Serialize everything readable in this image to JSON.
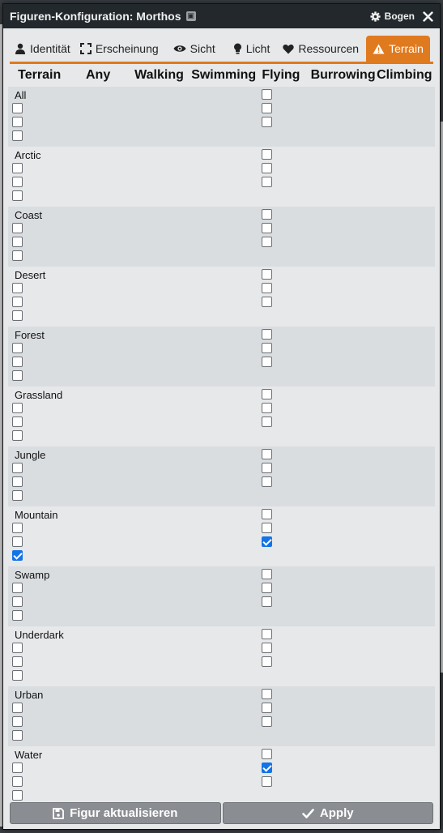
{
  "window": {
    "title": "Figuren-Konfiguration: Morthos",
    "sheet_label": "Bogen",
    "title_icon": "id-card-icon",
    "sheet_icon": "gear-icon",
    "close_icon": "close-icon"
  },
  "tabs": [
    {
      "label": "Identität",
      "icon": "user-icon",
      "active": false
    },
    {
      "label": "Erscheinung",
      "icon": "expand-icon",
      "active": false
    },
    {
      "label": "Sicht",
      "icon": "eye-icon",
      "active": false
    },
    {
      "label": "Licht",
      "icon": "lightbulb-icon",
      "active": false
    },
    {
      "label": "Ressourcen",
      "icon": "heart-icon",
      "active": false
    },
    {
      "label": "Terrain",
      "icon": "warning-triangle-icon",
      "active": true
    }
  ],
  "columns": [
    "Terrain",
    "Any",
    "Walking",
    "Swimming",
    "Flying",
    "Burrowing",
    "Climbing"
  ],
  "terrain_rows": [
    {
      "label": "All",
      "left": [
        false,
        false,
        false
      ],
      "flying": [
        false,
        false,
        false
      ]
    },
    {
      "label": "Arctic",
      "left": [
        false,
        false,
        false
      ],
      "flying": [
        false,
        false,
        false
      ]
    },
    {
      "label": "Coast",
      "left": [
        false,
        false,
        false
      ],
      "flying": [
        false,
        false,
        false
      ]
    },
    {
      "label": "Desert",
      "left": [
        false,
        false,
        false
      ],
      "flying": [
        false,
        false,
        false
      ]
    },
    {
      "label": "Forest",
      "left": [
        false,
        false,
        false
      ],
      "flying": [
        false,
        false,
        false
      ]
    },
    {
      "label": "Grassland",
      "left": [
        false,
        false,
        false
      ],
      "flying": [
        false,
        false,
        false
      ]
    },
    {
      "label": "Jungle",
      "left": [
        false,
        false,
        false
      ],
      "flying": [
        false,
        false,
        false
      ]
    },
    {
      "label": "Mountain",
      "left": [
        false,
        false,
        true
      ],
      "flying": [
        false,
        false,
        true
      ]
    },
    {
      "label": "Swamp",
      "left": [
        false,
        false,
        false
      ],
      "flying": [
        false,
        false,
        false
      ]
    },
    {
      "label": "Underdark",
      "left": [
        false,
        false,
        false
      ],
      "flying": [
        false,
        false,
        false
      ]
    },
    {
      "label": "Urban",
      "left": [
        false,
        false,
        false
      ],
      "flying": [
        false,
        false,
        false
      ]
    },
    {
      "label": "Water",
      "left": [
        false,
        false,
        false
      ],
      "flying": [
        false,
        true,
        false
      ]
    }
  ],
  "footer": {
    "update_label": "Figur aktualisieren",
    "update_icon": "save-icon",
    "apply_label": "Apply",
    "apply_icon": "check-icon"
  },
  "colors": {
    "accent": "#e07a1f",
    "checkbox_checked": "#1473e6",
    "titlebar": "#22282c"
  }
}
